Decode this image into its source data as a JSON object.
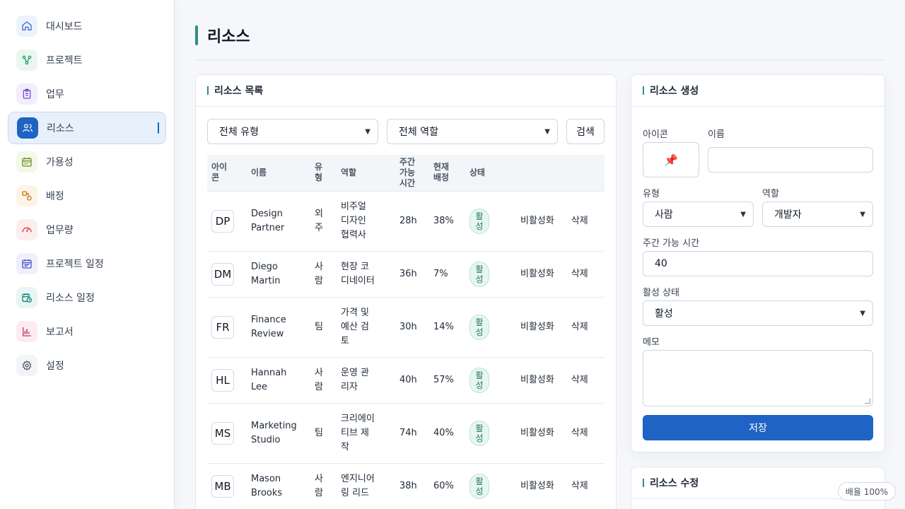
{
  "sidebar": {
    "items": [
      {
        "label": "대시보드",
        "icon": "home-icon",
        "color": "#3b6fd4",
        "bg": "#edf3fd",
        "active": false
      },
      {
        "label": "프로젝트",
        "icon": "project-icon",
        "color": "#1f9d6e",
        "bg": "#eaf7f1",
        "active": false
      },
      {
        "label": "업무",
        "icon": "clipboard-icon",
        "color": "#7c4ddb",
        "bg": "#f3eefc",
        "active": false
      },
      {
        "label": "리소스",
        "icon": "users-icon",
        "color": "#ffffff",
        "bg": "#1f63c4",
        "active": true
      },
      {
        "label": "가용성",
        "icon": "calendar-icon",
        "color": "#6b8e23",
        "bg": "#f3f8e8",
        "active": false
      },
      {
        "label": "배정",
        "icon": "assign-icon",
        "color": "#c67a12",
        "bg": "#fdf4e6",
        "active": false
      },
      {
        "label": "업무량",
        "icon": "gauge-icon",
        "color": "#d63d3d",
        "bg": "#fdeeee",
        "active": false
      },
      {
        "label": "프로젝트 일정",
        "icon": "schedule-icon",
        "color": "#4a55c7",
        "bg": "#eef0fc",
        "active": false
      },
      {
        "label": "리소스 일정",
        "icon": "clock-calendar-icon",
        "color": "#14877a",
        "bg": "#e7f6f3",
        "active": false
      },
      {
        "label": "보고서",
        "icon": "bar-chart-icon",
        "color": "#c23b66",
        "bg": "#fcecf1",
        "active": false
      },
      {
        "label": "설정",
        "icon": "gear-icon",
        "color": "#4b5563",
        "bg": "#f2f4f7",
        "active": false
      }
    ]
  },
  "page": {
    "title": "리소스"
  },
  "list": {
    "title": "리소스 목록",
    "filter_type": "전체 유형",
    "filter_role": "전체 역할",
    "search_label": "검색",
    "columns": [
      "아이\n콘",
      "이름",
      "유\n형",
      "역할",
      "주간\n가능\n시간",
      "현재\n배정",
      "상태",
      ""
    ],
    "rows": [
      {
        "avatar": "DP",
        "name": "Design\nPartner",
        "type": "외\n주",
        "role": "비주얼\n디자인\n협력사",
        "hours": "28h",
        "alloc": "38%",
        "status": "활\n성",
        "deactivate": "비활성화",
        "delete": "삭제",
        "tall": true
      },
      {
        "avatar": "DM",
        "name": "Diego\nMartin",
        "type": "사\n람",
        "role": "현장 코\n디네이터",
        "hours": "36h",
        "alloc": "7%",
        "status": "활\n성",
        "deactivate": "비활성화",
        "delete": "삭제",
        "tall": false
      },
      {
        "avatar": "FR",
        "name": "Finance\nReview",
        "type": "팀",
        "role": "가격 및\n예산 검\n토",
        "hours": "30h",
        "alloc": "14%",
        "status": "활\n성",
        "deactivate": "비활성화",
        "delete": "삭제",
        "tall": true
      },
      {
        "avatar": "HL",
        "name": "Hannah\nLee",
        "type": "사\n람",
        "role": "운영 관\n리자",
        "hours": "40h",
        "alloc": "57%",
        "status": "활\n성",
        "deactivate": "비활성화",
        "delete": "삭제",
        "tall": false
      },
      {
        "avatar": "MS",
        "name": "Marketing\nStudio",
        "type": "팀",
        "role": "크리에이\n티브 제\n작",
        "hours": "74h",
        "alloc": "40%",
        "status": "활\n성",
        "deactivate": "비활성화",
        "delete": "삭제",
        "tall": true
      },
      {
        "avatar": "MB",
        "name": "Mason\nBrooks",
        "type": "사\n람",
        "role": "엔지니어\n링 리드",
        "hours": "38h",
        "alloc": "60%",
        "status": "활\n성",
        "deactivate": "비활성화",
        "delete": "삭제",
        "tall": false
      }
    ]
  },
  "create": {
    "title": "리소스 생성",
    "icon_label": "아이콘",
    "icon_value": "📌",
    "name_label": "이름",
    "name_value": "",
    "type_label": "유형",
    "type_value": "사람",
    "role_label": "역할",
    "role_value": "개발자",
    "hours_label": "주간 가능 시간",
    "hours_value": "40",
    "status_label": "활성 상태",
    "status_value": "활성",
    "memo_label": "메모",
    "save_label": "저장"
  },
  "edit": {
    "title": "리소스 수정"
  },
  "zoom": {
    "label": "배율 100%"
  }
}
